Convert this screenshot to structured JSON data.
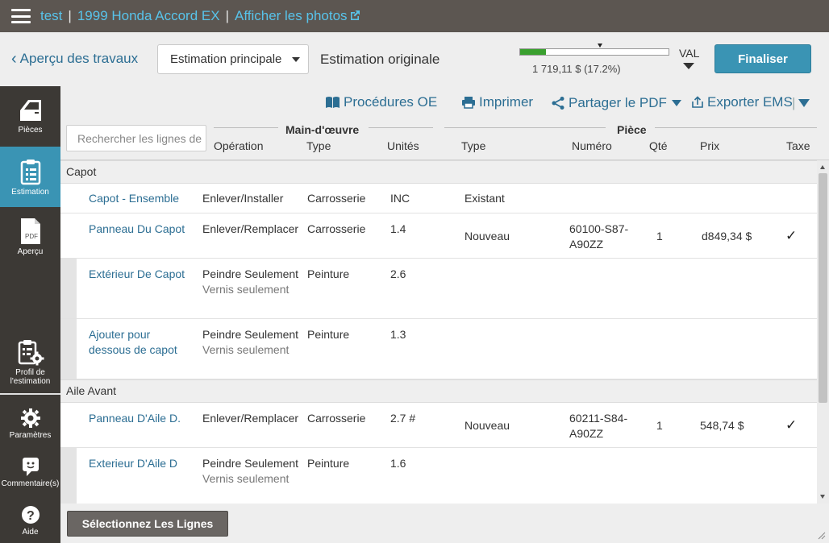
{
  "topbar": {
    "items": [
      "test",
      "1999 Honda Accord EX",
      "Afficher les photos"
    ]
  },
  "row2": {
    "back_label": "Aperçu des travaux",
    "estimate_select": "Estimation principale",
    "orig_label": "Estimation originale",
    "progress_text": "1 719,11 $ (17.2%)",
    "progress_fraction": 0.172,
    "val_label": "VAL",
    "finalize_label": "Finaliser"
  },
  "sidebar": {
    "items": [
      {
        "label": "Pièces",
        "icon": "door-icon"
      },
      {
        "label": "Estimation",
        "icon": "clipboard-list-icon"
      },
      {
        "label": "Aperçu",
        "icon": "pdf-icon"
      },
      {
        "label": "Profil de l'estimation",
        "icon": "clipboard-gear-icon"
      },
      {
        "label": "Paramètres",
        "icon": "gear-icon"
      },
      {
        "label": "Commentaire(s)",
        "icon": "comment-icon"
      },
      {
        "label": "Aide",
        "icon": "help-icon"
      }
    ]
  },
  "actions": {
    "procedures": "Procédures OE",
    "print": "Imprimer",
    "share_pdf": "Partager le PDF",
    "export_ems": "Exporter EMS"
  },
  "search": {
    "placeholder": "Rechercher les lignes de"
  },
  "headers": {
    "group_labor": "Main-d'œuvre",
    "group_part": "Pièce",
    "operation": "Opération",
    "type": "Type",
    "units": "Unités",
    "part_type": "Type",
    "number": "Numéro",
    "qty": "Qté",
    "price": "Prix",
    "tax": "Taxe"
  },
  "sections": [
    {
      "name": "Capot",
      "lines": [
        {
          "name": "Capot - Ensemble",
          "operation": "Enlever/Installer",
          "operation_sub": "",
          "labor_type": "Carrosserie",
          "units": "INC",
          "part_type": "Existant",
          "number": "",
          "qty": "",
          "price": "",
          "tax": ""
        },
        {
          "name": "Panneau Du Capot",
          "operation": "Enlever/Remplacer",
          "operation_sub": "",
          "labor_type": "Carrosserie",
          "units": "1.4",
          "part_type": "Nouveau",
          "number": "60100-S87-A90ZZ",
          "qty": "1",
          "price": "d849,34 $",
          "tax": "✓"
        },
        {
          "name": "Extérieur De Capot",
          "operation": "Peindre Seulement",
          "operation_sub": "Vernis seulement",
          "labor_type": "Peinture",
          "units": "2.6",
          "part_type": "",
          "number": "",
          "qty": "",
          "price": "",
          "tax": ""
        },
        {
          "name": "Ajouter pour dessous de capot",
          "operation": "Peindre Seulement",
          "operation_sub": "Vernis seulement",
          "labor_type": "Peinture",
          "units": "1.3",
          "part_type": "",
          "number": "",
          "qty": "",
          "price": "",
          "tax": ""
        }
      ]
    },
    {
      "name": "Aile Avant",
      "lines": [
        {
          "name": "Panneau D'Aile D.",
          "operation": "Enlever/Remplacer",
          "operation_sub": "",
          "labor_type": "Carrosserie",
          "units": "2.7 #",
          "part_type": "Nouveau",
          "number": "60211-S84-A90ZZ",
          "qty": "1",
          "price": "548,74 $",
          "tax": "✓"
        },
        {
          "name": "Exterieur D'Aile D",
          "operation": "Peindre Seulement",
          "operation_sub": "Vernis seulement",
          "labor_type": "Peinture",
          "units": "1.6",
          "part_type": "",
          "number": "",
          "qty": "",
          "price": "",
          "tax": ""
        }
      ]
    }
  ],
  "footer": {
    "select_lines": "Sélectionnez Les Lignes"
  },
  "colors": {
    "topbar": "#5c5651",
    "accent": "#3a94b4",
    "link": "#2c6e93",
    "topbar_link": "#58c3ea",
    "progress": "#3aa02f"
  }
}
